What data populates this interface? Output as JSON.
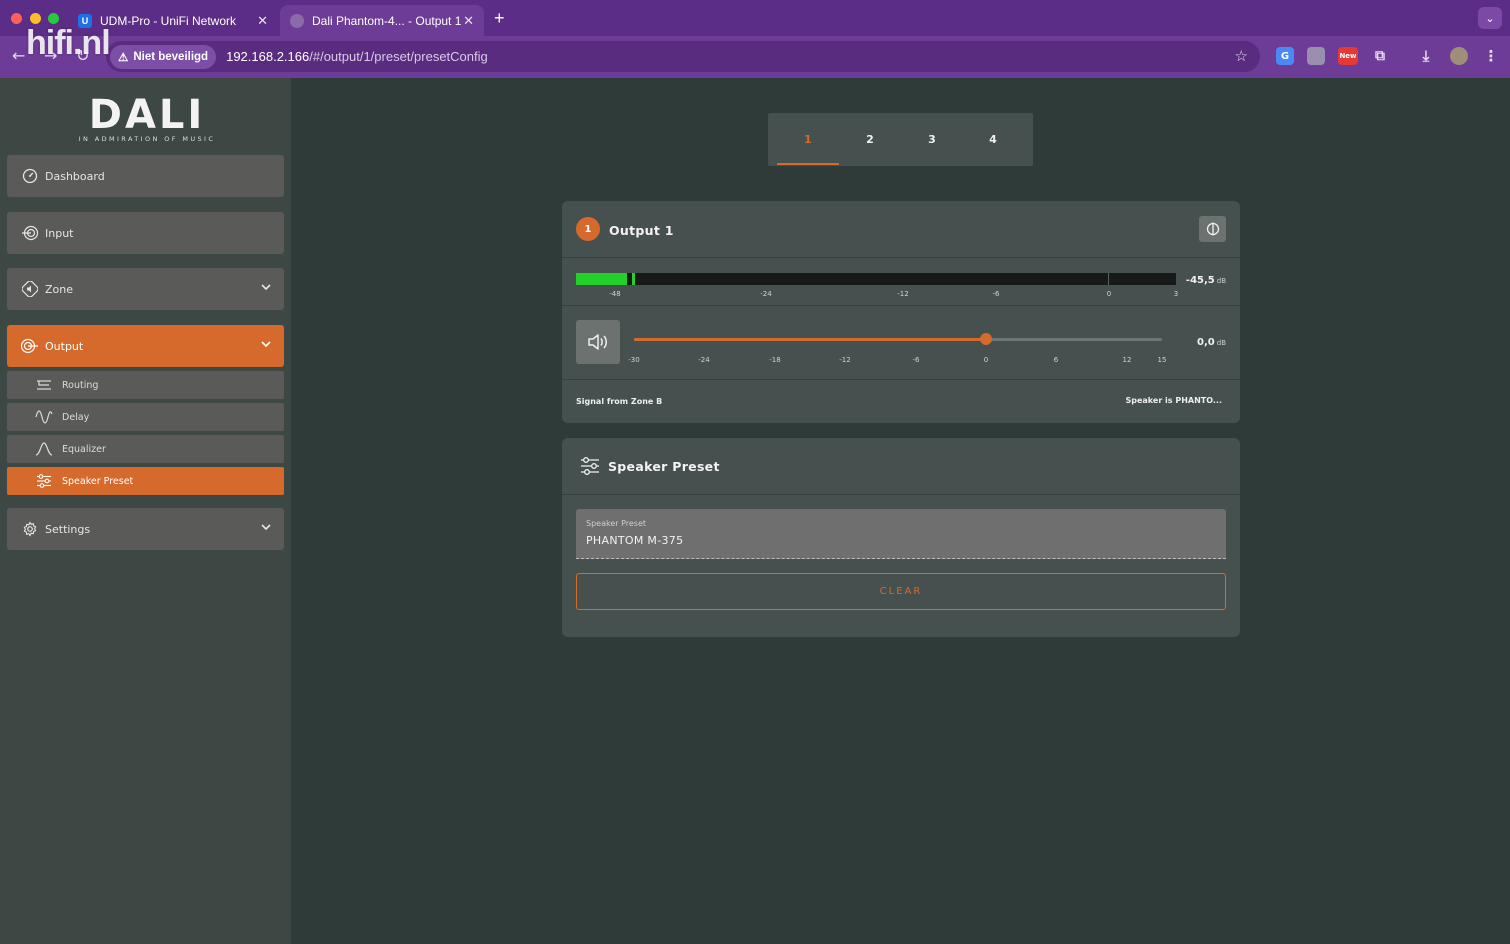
{
  "browser": {
    "tabs": [
      {
        "title": "UDM-Pro - UniFi Network",
        "favicon": "U"
      },
      {
        "title": "Dali Phantom-4... - Output 1",
        "favicon": ""
      }
    ],
    "security_label": "Niet beveiligd",
    "url_host": "192.168.2.166",
    "url_path": "/#/output/1/preset/presetConfig",
    "ext_new_badge": "New",
    "watermark": "hifi.nl"
  },
  "brand": {
    "name": "DALI",
    "tagline": "IN ADMIRATION OF MUSIC"
  },
  "sidebar": {
    "items": [
      {
        "label": "Dashboard",
        "icon": "gauge-icon"
      },
      {
        "label": "Input",
        "icon": "input-icon"
      },
      {
        "label": "Zone",
        "icon": "zone-speaker-icon"
      },
      {
        "label": "Output",
        "icon": "output-icon"
      },
      {
        "label": "Settings",
        "icon": "gear-icon"
      }
    ],
    "output_sub": [
      {
        "label": "Routing",
        "icon": "routing-icon"
      },
      {
        "label": "Delay",
        "icon": "wave-icon"
      },
      {
        "label": "Equalizer",
        "icon": "curve-icon"
      },
      {
        "label": "Speaker Preset",
        "icon": "sliders-icon"
      }
    ]
  },
  "output_tabs": [
    "1",
    "2",
    "3",
    "4"
  ],
  "active_output_tab": "1",
  "output_card": {
    "badge": "1",
    "title": "Output 1",
    "meter": {
      "ticks": [
        "-48",
        "-24",
        "-12",
        "-6",
        "0",
        "3"
      ],
      "level_db": "-45,5",
      "unit": "dB"
    },
    "volume": {
      "ticks": [
        "-30",
        "-24",
        "-18",
        "-12",
        "-6",
        "0",
        "6",
        "12",
        "15"
      ],
      "value_db": "0,0",
      "unit": "dB",
      "min": -30,
      "max": 15,
      "value": 0
    },
    "signal_text": "Signal from Zone B",
    "speaker_text": "Speaker is PHANTO..."
  },
  "preset_card": {
    "title": "Speaker Preset",
    "field_label": "Speaker Preset",
    "field_value": "PHANTOM M-375",
    "clear_label": "CLEAR"
  },
  "colors": {
    "accent": "#d66a2c",
    "meter_green": "#24d12a",
    "browser_purple": "#6c3c97"
  }
}
